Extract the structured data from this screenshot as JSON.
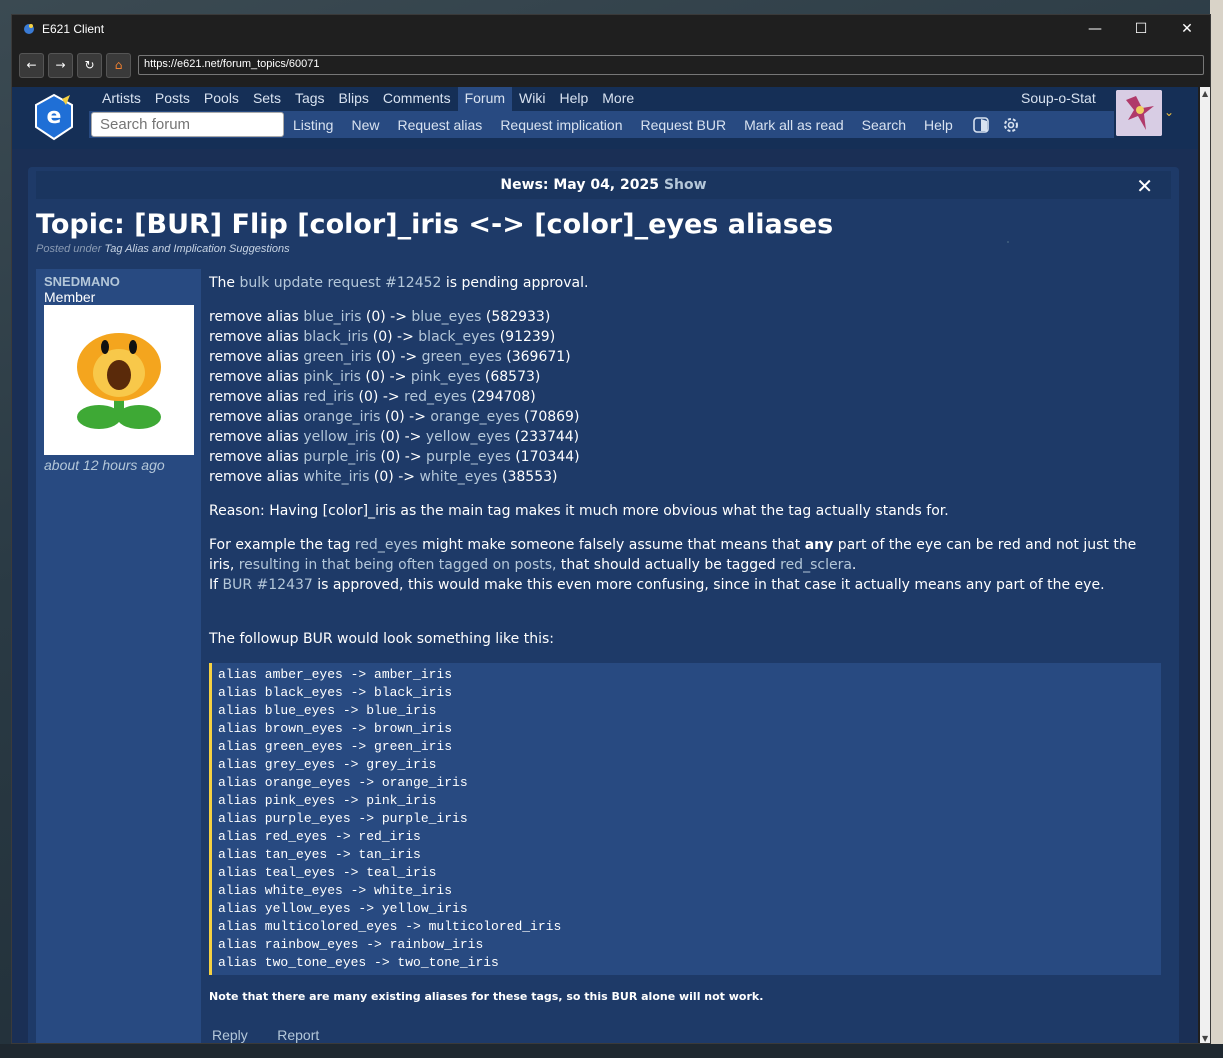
{
  "window": {
    "title": "E621 Client",
    "url": "https://e621.net/forum_topics/60071",
    "controls": {
      "minimize": "—",
      "maximize": "☐",
      "close": "✕"
    },
    "nav": {
      "back": "←",
      "forward": "→",
      "reload": "↻",
      "home": "⌂"
    }
  },
  "site": {
    "logo_text": "e",
    "nav_main": [
      "Artists",
      "Posts",
      "Pools",
      "Sets",
      "Tags",
      "Blips",
      "Comments",
      "Forum",
      "Wiki",
      "Help",
      "More"
    ],
    "active_nav": "Forum",
    "search_placeholder": "Search forum",
    "nav_sub": [
      "Listing",
      "New",
      "Request alias",
      "Request implication",
      "Request BUR",
      "Mark all as read",
      "Search",
      "Help"
    ],
    "username": "Soup-o-Stat"
  },
  "news": {
    "label": "News: May 04, 2025",
    "show": "Show",
    "close": "✕"
  },
  "topic": {
    "title": "Topic: [BUR] Flip [color]_iris <-> [color]_eyes aliases",
    "posted_prefix": "Posted under",
    "category": "Tag Alias and Implication Suggestions"
  },
  "post": {
    "author": "SNEDMANO",
    "level": "Member",
    "time": "about 12 hours ago",
    "intro_pre": "The",
    "intro_link": "bulk update request #12452",
    "intro_post": "is pending approval.",
    "aliases": [
      {
        "from": "blue_iris",
        "to": "blue_eyes",
        "count": "(582933)"
      },
      {
        "from": "black_iris",
        "to": "black_eyes",
        "count": "(91239)"
      },
      {
        "from": "green_iris",
        "to": "green_eyes",
        "count": "(369671)"
      },
      {
        "from": "pink_iris",
        "to": "pink_eyes",
        "count": "(68573)"
      },
      {
        "from": "red_iris",
        "to": "red_eyes",
        "count": "(294708)"
      },
      {
        "from": "orange_iris",
        "to": "orange_eyes",
        "count": "(70869)"
      },
      {
        "from": "yellow_iris",
        "to": "yellow_eyes",
        "count": "(233744)"
      },
      {
        "from": "purple_iris",
        "to": "purple_eyes",
        "count": "(170344)"
      },
      {
        "from": "white_iris",
        "to": "white_eyes",
        "count": "(38553)"
      }
    ],
    "remove_prefix": "remove alias",
    "zero": "(0) ->",
    "reason": "Reason: Having [color]_iris as the main tag makes it much more obvious what the tag actually stands for.",
    "example_1": "For example the tag",
    "example_link_1": "red_eyes",
    "example_2": "might make someone falsely assume that means that",
    "example_bold": "any",
    "example_3": "part of the eye can be red and not just the iris,",
    "example_link_2": "resulting in that being often tagged on posts,",
    "example_4": "that should actually be tagged",
    "example_link_3": "red_sclera",
    "example_5": ".",
    "if_1": "If",
    "if_link": "BUR #12437",
    "if_2": "is approved, this would make this even more confusing, since in that case it actually means any part of the eye.",
    "followup": "The followup BUR would look something like this:",
    "code_lines": [
      "alias amber_eyes -> amber_iris",
      "alias black_eyes -> black_iris",
      "alias blue_eyes -> blue_iris",
      "alias brown_eyes -> brown_iris",
      "alias green_eyes -> green_iris",
      "alias grey_eyes -> grey_iris",
      "alias orange_eyes -> orange_iris",
      "alias pink_eyes -> pink_iris",
      "alias purple_eyes -> purple_iris",
      "alias red_eyes -> red_iris",
      "alias tan_eyes -> tan_iris",
      "alias teal_eyes -> teal_iris",
      "alias white_eyes -> white_iris",
      "alias yellow_eyes -> yellow_iris",
      "alias multicolored_eyes -> multicolored_iris",
      "alias rainbow_eyes -> rainbow_iris",
      "alias two_tone_eyes -> two_tone_iris"
    ],
    "note": "Note that there are many existing aliases for these tags, so this BUR alone will not work.",
    "reply": "Reply",
    "report": "Report"
  },
  "colors": {
    "accent": "#f5d142",
    "link": "#b4c7d9",
    "bg": "#1e3a68",
    "nav": "#284a81"
  }
}
